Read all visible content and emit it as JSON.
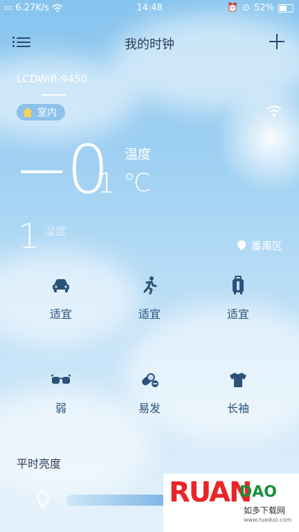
{
  "status_bar": {
    "network_speed": "6.27K/s",
    "time": "14:48",
    "battery_percent": "52%"
  },
  "header": {
    "title": "我的时钟"
  },
  "device": {
    "name": "LCDWifi-9450",
    "room": "室内"
  },
  "temperature": {
    "value": "−0",
    "decimal": ".1",
    "label": "温度",
    "unit": "℃"
  },
  "humidity": {
    "value": "1",
    "label": "湿度"
  },
  "location": {
    "district": "番禺区"
  },
  "indices_row1": [
    {
      "icon": "car-icon",
      "label": "适宜"
    },
    {
      "icon": "running-icon",
      "label": "适宜"
    },
    {
      "icon": "luggage-icon",
      "label": "适宜"
    }
  ],
  "indices_row2": [
    {
      "icon": "glasses-icon",
      "label": "弱"
    },
    {
      "icon": "pill-icon",
      "label": "易发"
    },
    {
      "icon": "tshirt-icon",
      "label": "长袖"
    }
  ],
  "brightness": {
    "label": "平时亮度",
    "level": 0.6
  },
  "watermark": {
    "brand": "RUAN",
    "brand2": "DAO",
    "tagline": "如多下载网",
    "url": "www.ruaduo.com"
  }
}
